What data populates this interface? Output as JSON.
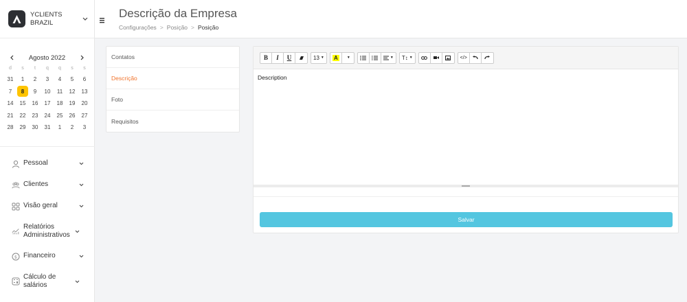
{
  "brand": {
    "name_line1": "YCLIENTS",
    "name_line2": "BRAZIL"
  },
  "calendar": {
    "month": "Agosto 2022",
    "weekdays": [
      "d",
      "s",
      "t",
      "q",
      "q",
      "s",
      "s"
    ],
    "days": [
      "31",
      "1",
      "2",
      "3",
      "4",
      "5",
      "6",
      "7",
      "8",
      "9",
      "10",
      "11",
      "12",
      "13",
      "14",
      "15",
      "16",
      "17",
      "18",
      "19",
      "20",
      "21",
      "22",
      "23",
      "24",
      "25",
      "26",
      "27",
      "28",
      "29",
      "30",
      "31",
      "1",
      "2",
      "3"
    ],
    "today": "8"
  },
  "menu": [
    {
      "label": "Pessoal",
      "icon": "person-icon"
    },
    {
      "label": "Clientes",
      "icon": "clients-icon"
    },
    {
      "label": "Visão geral",
      "icon": "grid-icon"
    },
    {
      "label": "Relatórios Administrativos",
      "icon": "chart-icon"
    },
    {
      "label": "Financeiro",
      "icon": "coin-icon"
    },
    {
      "label": "Cálculo de salários",
      "icon": "calculator-icon"
    }
  ],
  "header": {
    "title": "Descrição da Empresa",
    "breadcrumb": [
      "Configurações",
      "Posição",
      "Posição"
    ]
  },
  "tabs": [
    {
      "label": "Contatos",
      "active": false
    },
    {
      "label": "Descrição",
      "active": true
    },
    {
      "label": "Foto",
      "active": false
    },
    {
      "label": "Requisitos",
      "active": false
    }
  ],
  "editor": {
    "font_size": "13",
    "content": "Description",
    "code_label": "</>",
    "style_label": "T↕"
  },
  "save_label": "Salvar",
  "colors": {
    "accent": "#f0742d",
    "save": "#54c6e0",
    "today": "#ffc400"
  }
}
